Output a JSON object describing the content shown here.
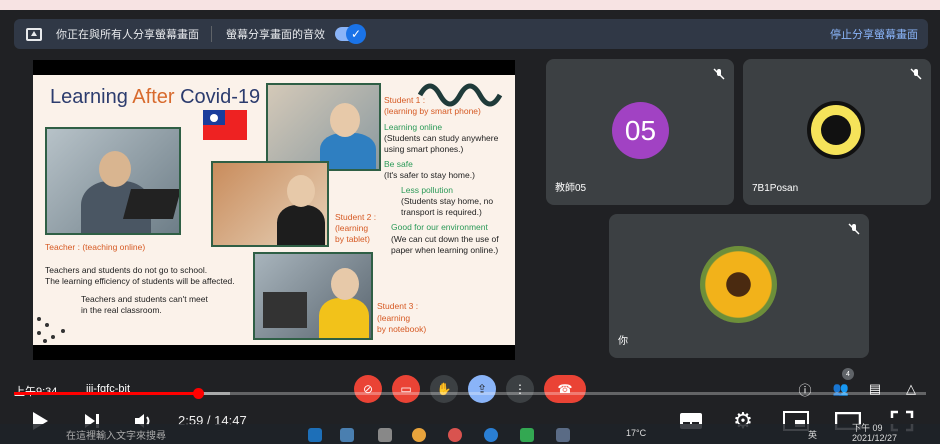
{
  "share_bar": {
    "sharing_text": "你正在與所有人分享螢幕畫面",
    "audio_text": "螢幕分享畫面的音效",
    "stop_text": "停止分享螢幕畫面"
  },
  "slide": {
    "title_a": "Learning ",
    "title_b": "After",
    "title_c": " Covid-19",
    "student1_head": "Student 1 :",
    "student1_sub": "(learning by smart phone)",
    "learning_online": "Learning online",
    "learning_online_desc1": "(Students can study anywhere",
    "learning_online_desc2": "using smart phones.)",
    "be_safe": "Be safe",
    "be_safe_desc": "(It's safer to stay home.)",
    "less_pollution": "Less pollution",
    "less_pollution_desc1": "(Students stay home, no",
    "less_pollution_desc2": "transport is required.)",
    "good_env": "Good for our environment",
    "good_env_desc1": "(We can cut down the use of",
    "good_env_desc2": "paper when learning online.)",
    "student2_head": "Student 2 :",
    "student2_sub1": "(learning",
    "student2_sub2": "by tablet)",
    "teacher": "Teacher : (teaching online)",
    "teacher_line1": "Teachers and students do not go to school.",
    "teacher_line2": "The learning efficiency of students will be affected.",
    "teacher_line3": "Teachers and students can't meet",
    "teacher_line4": "in the real classroom.",
    "student3_head": "Student 3 :",
    "student3_sub1": "(learning",
    "student3_sub2": "by notebook)"
  },
  "participants": [
    {
      "name": "教師05",
      "avatar_text": "05",
      "avatar_color": "#a142c3"
    },
    {
      "name": "7B1Posan"
    },
    {
      "name": "你"
    }
  ],
  "meet_toolbar": {
    "time": "上午9:34",
    "meeting_code": "iii-fgfc-bit",
    "people_count": "4"
  },
  "player": {
    "current_time": "2:59",
    "separator": " / ",
    "duration": "14:47",
    "progress_fraction": 0.202
  },
  "taskbar": {
    "search_placeholder": "在這裡輸入文字來搜尋",
    "temperature": "17°C",
    "ime": "英",
    "clock_time": "下午 09",
    "clock_date": "2021/12/27"
  },
  "colors": {
    "background": "#202124",
    "tile": "#3c4043",
    "accent_blue": "#8ab4f8",
    "danger_red": "#ea4335",
    "progress_red": "#ff0000"
  }
}
